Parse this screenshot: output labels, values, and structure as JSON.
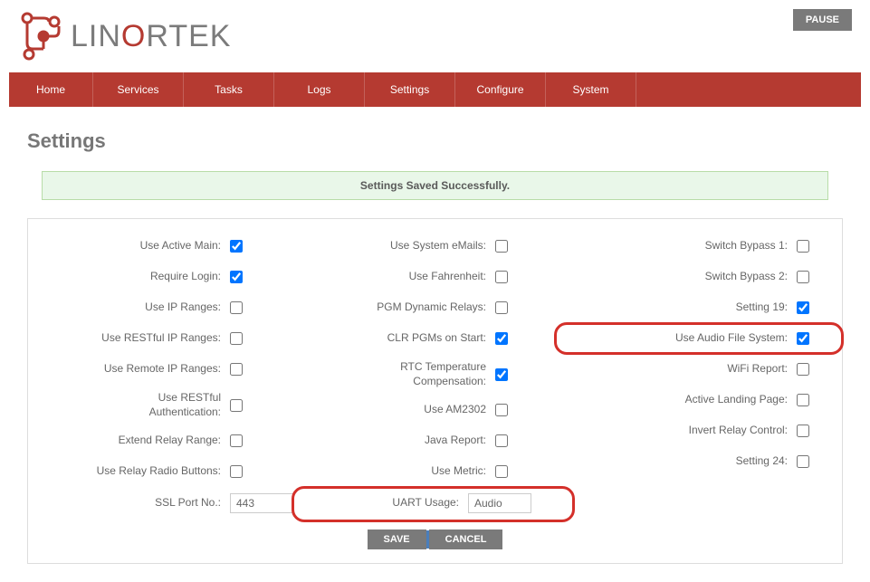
{
  "brand": {
    "part1": "LIN",
    "accent": "O",
    "part2": "RTEK"
  },
  "header": {
    "pause": "PAUSE"
  },
  "nav": {
    "items": [
      "Home",
      "Services",
      "Tasks",
      "Logs",
      "Settings",
      "Configure",
      "System"
    ]
  },
  "page": {
    "title": "Settings"
  },
  "banner": {
    "message": "Settings Saved Successfully."
  },
  "settings": {
    "col1": [
      {
        "label": "Use Active Main:",
        "checked": true
      },
      {
        "label": "Require Login:",
        "checked": true
      },
      {
        "label": "Use IP Ranges:",
        "checked": false
      },
      {
        "label": "Use RESTful IP Ranges:",
        "checked": false
      },
      {
        "label": "Use Remote IP Ranges:",
        "checked": false
      },
      {
        "label": "Use RESTful Authentication:",
        "checked": false
      },
      {
        "label": "Extend Relay Range:",
        "checked": false
      },
      {
        "label": "Use Relay Radio Buttons:",
        "checked": false
      }
    ],
    "ssl": {
      "label": "SSL Port No.:",
      "value": "443"
    },
    "col2": [
      {
        "label": "Use System eMails:",
        "checked": false
      },
      {
        "label": "Use Fahrenheit:",
        "checked": false
      },
      {
        "label": "PGM Dynamic Relays:",
        "checked": false
      },
      {
        "label": "CLR PGMs on Start:",
        "checked": true
      },
      {
        "label": "RTC Temperature Compensation:",
        "checked": true
      },
      {
        "label": "Use AM2302",
        "checked": false
      },
      {
        "label": "Java Report:",
        "checked": false
      },
      {
        "label": "Use Metric:",
        "checked": false
      }
    ],
    "uart": {
      "label": "UART Usage:",
      "value": "Audio"
    },
    "col3": [
      {
        "label": "Switch Bypass 1:",
        "checked": false
      },
      {
        "label": "Switch Bypass 2:",
        "checked": false
      },
      {
        "label": "Setting 19:",
        "checked": true
      },
      {
        "label": "Use Audio File System:",
        "checked": true
      },
      {
        "label": "WiFi Report:",
        "checked": false
      },
      {
        "label": "Active Landing Page:",
        "checked": false
      },
      {
        "label": "Invert Relay Control:",
        "checked": false
      },
      {
        "label": "Setting 24:",
        "checked": false
      }
    ]
  },
  "buttons": {
    "save": "SAVE",
    "cancel": "CANCEL"
  }
}
